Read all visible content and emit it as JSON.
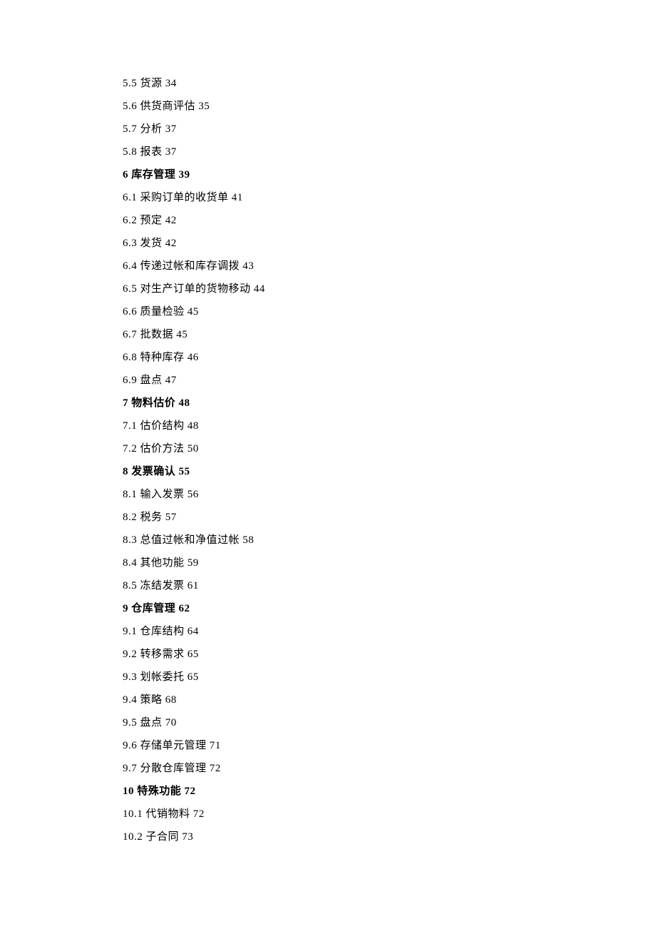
{
  "toc": [
    {
      "type": "item",
      "num": "5.5",
      "title": "货源",
      "page": "34"
    },
    {
      "type": "item",
      "num": "5.6",
      "title": "供货商评估",
      "page": "35"
    },
    {
      "type": "item",
      "num": "5.7",
      "title": "分析",
      "page": "37"
    },
    {
      "type": "item",
      "num": "5.8",
      "title": "报表",
      "page": "37"
    },
    {
      "type": "head",
      "num": "6",
      "title": "库存管理",
      "page": "39"
    },
    {
      "type": "item",
      "num": "6.1",
      "title": "采购订单的收货单",
      "page": "41"
    },
    {
      "type": "item",
      "num": "6.2",
      "title": "预定",
      "page": "42"
    },
    {
      "type": "item",
      "num": "6.3",
      "title": "发货",
      "page": "42"
    },
    {
      "type": "item",
      "num": "6.4",
      "title": "传递过帐和库存调拨",
      "page": "43"
    },
    {
      "type": "item",
      "num": "6.5",
      "title": "对生产订单的货物移动",
      "page": "44"
    },
    {
      "type": "item",
      "num": "6.6",
      "title": "质量检验",
      "page": "45"
    },
    {
      "type": "item",
      "num": "6.7",
      "title": "批数据",
      "page": "45"
    },
    {
      "type": "item",
      "num": "6.8",
      "title": "特种库存",
      "page": "46"
    },
    {
      "type": "item",
      "num": "6.9",
      "title": "盘点",
      "page": "47"
    },
    {
      "type": "head",
      "num": "7",
      "title": "物料估价",
      "page": "48"
    },
    {
      "type": "item",
      "num": "7.1",
      "title": "估价结构",
      "page": "48"
    },
    {
      "type": "item",
      "num": "7.2",
      "title": "估价方法",
      "page": "50"
    },
    {
      "type": "head",
      "num": "8",
      "title": "发票确认",
      "page": "55"
    },
    {
      "type": "item",
      "num": "8.1",
      "title": "输入发票",
      "page": "56"
    },
    {
      "type": "item",
      "num": "8.2",
      "title": "税务",
      "page": "57"
    },
    {
      "type": "item",
      "num": "8.3",
      "title": "总值过帐和净值过帐",
      "page": "58"
    },
    {
      "type": "item",
      "num": "8.4",
      "title": "其他功能",
      "page": "59"
    },
    {
      "type": "item",
      "num": "8.5",
      "title": "冻结发票",
      "page": "61"
    },
    {
      "type": "head",
      "num": "9",
      "title": "仓库管理",
      "page": "62"
    },
    {
      "type": "item",
      "num": "9.1",
      "title": "仓库结构",
      "page": "64"
    },
    {
      "type": "item",
      "num": "9.2",
      "title": "转移需求",
      "page": "65"
    },
    {
      "type": "item",
      "num": "9.3",
      "title": "划帐委托",
      "page": "65"
    },
    {
      "type": "item",
      "num": "9.4",
      "title": "策略",
      "page": "68"
    },
    {
      "type": "item",
      "num": "9.5",
      "title": "盘点",
      "page": "70"
    },
    {
      "type": "item",
      "num": "9.6",
      "title": "存储单元管理",
      "page": "71"
    },
    {
      "type": "item",
      "num": "9.7",
      "title": "分散仓库管理",
      "page": "72"
    },
    {
      "type": "head",
      "num": "10",
      "title": "特殊功能",
      "page": "72"
    },
    {
      "type": "item",
      "num": "10.1",
      "title": "代销物料",
      "page": "72"
    },
    {
      "type": "item",
      "num": "10.2",
      "title": "子合同",
      "page": "73"
    }
  ]
}
